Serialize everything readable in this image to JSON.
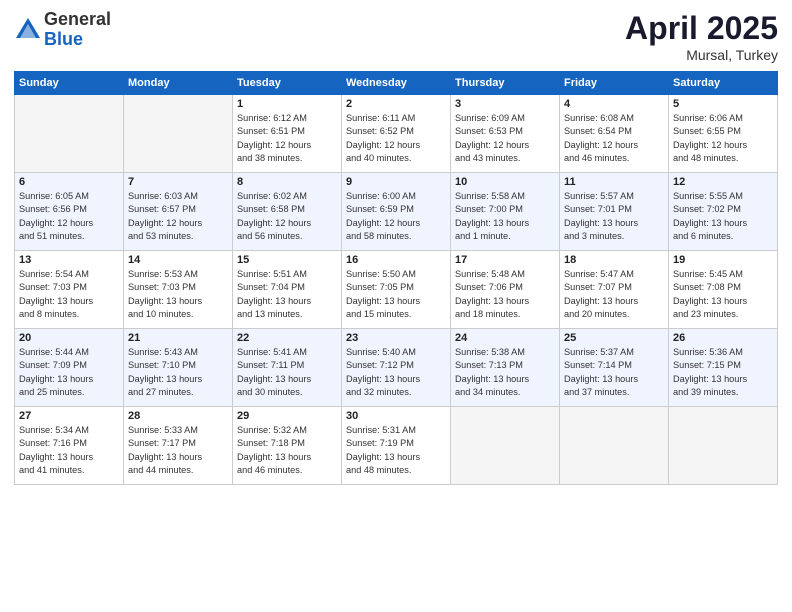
{
  "logo": {
    "general": "General",
    "blue": "Blue"
  },
  "title": "April 2025",
  "location": "Mursal, Turkey",
  "days_header": [
    "Sunday",
    "Monday",
    "Tuesday",
    "Wednesday",
    "Thursday",
    "Friday",
    "Saturday"
  ],
  "weeks": [
    [
      {
        "num": "",
        "info": ""
      },
      {
        "num": "",
        "info": ""
      },
      {
        "num": "1",
        "info": "Sunrise: 6:12 AM\nSunset: 6:51 PM\nDaylight: 12 hours\nand 38 minutes."
      },
      {
        "num": "2",
        "info": "Sunrise: 6:11 AM\nSunset: 6:52 PM\nDaylight: 12 hours\nand 40 minutes."
      },
      {
        "num": "3",
        "info": "Sunrise: 6:09 AM\nSunset: 6:53 PM\nDaylight: 12 hours\nand 43 minutes."
      },
      {
        "num": "4",
        "info": "Sunrise: 6:08 AM\nSunset: 6:54 PM\nDaylight: 12 hours\nand 46 minutes."
      },
      {
        "num": "5",
        "info": "Sunrise: 6:06 AM\nSunset: 6:55 PM\nDaylight: 12 hours\nand 48 minutes."
      }
    ],
    [
      {
        "num": "6",
        "info": "Sunrise: 6:05 AM\nSunset: 6:56 PM\nDaylight: 12 hours\nand 51 minutes."
      },
      {
        "num": "7",
        "info": "Sunrise: 6:03 AM\nSunset: 6:57 PM\nDaylight: 12 hours\nand 53 minutes."
      },
      {
        "num": "8",
        "info": "Sunrise: 6:02 AM\nSunset: 6:58 PM\nDaylight: 12 hours\nand 56 minutes."
      },
      {
        "num": "9",
        "info": "Sunrise: 6:00 AM\nSunset: 6:59 PM\nDaylight: 12 hours\nand 58 minutes."
      },
      {
        "num": "10",
        "info": "Sunrise: 5:58 AM\nSunset: 7:00 PM\nDaylight: 13 hours\nand 1 minute."
      },
      {
        "num": "11",
        "info": "Sunrise: 5:57 AM\nSunset: 7:01 PM\nDaylight: 13 hours\nand 3 minutes."
      },
      {
        "num": "12",
        "info": "Sunrise: 5:55 AM\nSunset: 7:02 PM\nDaylight: 13 hours\nand 6 minutes."
      }
    ],
    [
      {
        "num": "13",
        "info": "Sunrise: 5:54 AM\nSunset: 7:03 PM\nDaylight: 13 hours\nand 8 minutes."
      },
      {
        "num": "14",
        "info": "Sunrise: 5:53 AM\nSunset: 7:03 PM\nDaylight: 13 hours\nand 10 minutes."
      },
      {
        "num": "15",
        "info": "Sunrise: 5:51 AM\nSunset: 7:04 PM\nDaylight: 13 hours\nand 13 minutes."
      },
      {
        "num": "16",
        "info": "Sunrise: 5:50 AM\nSunset: 7:05 PM\nDaylight: 13 hours\nand 15 minutes."
      },
      {
        "num": "17",
        "info": "Sunrise: 5:48 AM\nSunset: 7:06 PM\nDaylight: 13 hours\nand 18 minutes."
      },
      {
        "num": "18",
        "info": "Sunrise: 5:47 AM\nSunset: 7:07 PM\nDaylight: 13 hours\nand 20 minutes."
      },
      {
        "num": "19",
        "info": "Sunrise: 5:45 AM\nSunset: 7:08 PM\nDaylight: 13 hours\nand 23 minutes."
      }
    ],
    [
      {
        "num": "20",
        "info": "Sunrise: 5:44 AM\nSunset: 7:09 PM\nDaylight: 13 hours\nand 25 minutes."
      },
      {
        "num": "21",
        "info": "Sunrise: 5:43 AM\nSunset: 7:10 PM\nDaylight: 13 hours\nand 27 minutes."
      },
      {
        "num": "22",
        "info": "Sunrise: 5:41 AM\nSunset: 7:11 PM\nDaylight: 13 hours\nand 30 minutes."
      },
      {
        "num": "23",
        "info": "Sunrise: 5:40 AM\nSunset: 7:12 PM\nDaylight: 13 hours\nand 32 minutes."
      },
      {
        "num": "24",
        "info": "Sunrise: 5:38 AM\nSunset: 7:13 PM\nDaylight: 13 hours\nand 34 minutes."
      },
      {
        "num": "25",
        "info": "Sunrise: 5:37 AM\nSunset: 7:14 PM\nDaylight: 13 hours\nand 37 minutes."
      },
      {
        "num": "26",
        "info": "Sunrise: 5:36 AM\nSunset: 7:15 PM\nDaylight: 13 hours\nand 39 minutes."
      }
    ],
    [
      {
        "num": "27",
        "info": "Sunrise: 5:34 AM\nSunset: 7:16 PM\nDaylight: 13 hours\nand 41 minutes."
      },
      {
        "num": "28",
        "info": "Sunrise: 5:33 AM\nSunset: 7:17 PM\nDaylight: 13 hours\nand 44 minutes."
      },
      {
        "num": "29",
        "info": "Sunrise: 5:32 AM\nSunset: 7:18 PM\nDaylight: 13 hours\nand 46 minutes."
      },
      {
        "num": "30",
        "info": "Sunrise: 5:31 AM\nSunset: 7:19 PM\nDaylight: 13 hours\nand 48 minutes."
      },
      {
        "num": "",
        "info": ""
      },
      {
        "num": "",
        "info": ""
      },
      {
        "num": "",
        "info": ""
      }
    ]
  ]
}
